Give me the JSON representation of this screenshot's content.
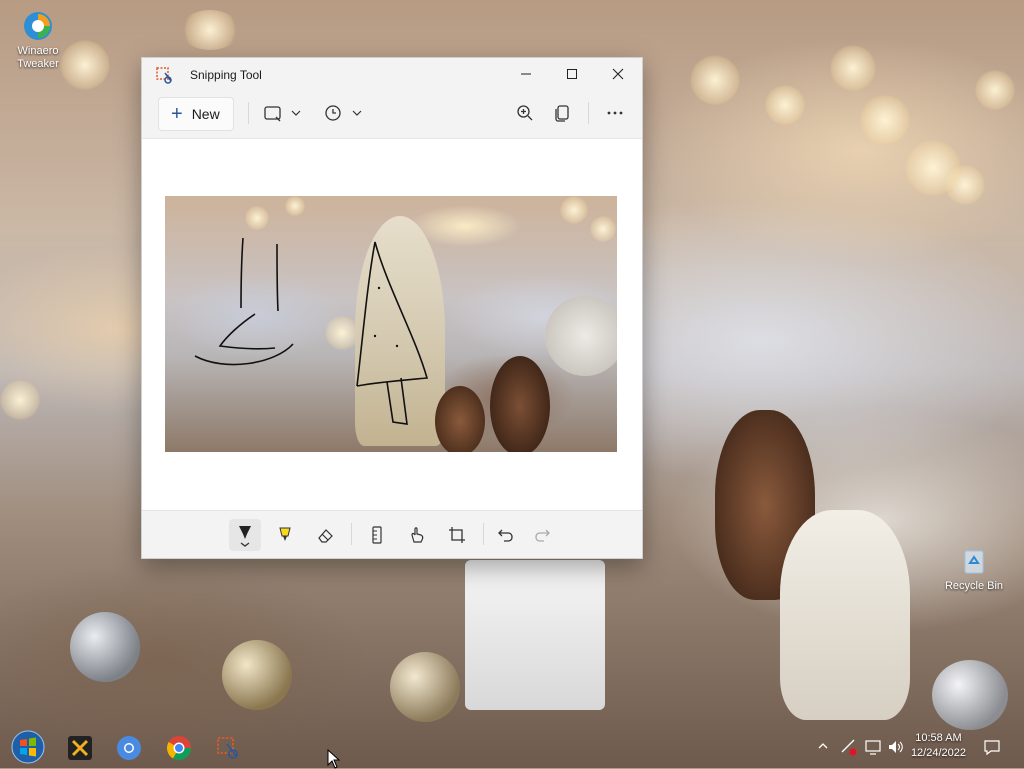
{
  "desktop": {
    "icons": [
      {
        "label": "Winaero Tweaker",
        "icon": "winaero-tweaker-icon"
      },
      {
        "label": "Recycle Bin",
        "icon": "recycle-bin-icon"
      }
    ]
  },
  "window": {
    "title": "Snipping Tool",
    "app_icon": "scissors-icon",
    "controls": {
      "minimize": "minimize-icon",
      "maximize": "maximize-icon",
      "close": "close-icon"
    },
    "toolbar": {
      "new_label": "New",
      "new_icon": "plus-icon",
      "snip_mode_icon": "rectangle-snip-icon",
      "delay_icon": "clock-icon",
      "zoom_icon": "zoom-in-icon",
      "copy_icon": "copy-icon",
      "more_icon": "more-icon"
    },
    "draw_tools": [
      {
        "name": "ballpoint-pen",
        "icon": "pen-icon",
        "active": true
      },
      {
        "name": "highlighter",
        "icon": "highlighter-icon",
        "active": false
      },
      {
        "name": "eraser",
        "icon": "eraser-icon",
        "active": false
      },
      {
        "name": "ruler",
        "icon": "ruler-icon",
        "active": false
      },
      {
        "name": "touch-writing",
        "icon": "touch-writing-icon",
        "active": false
      },
      {
        "name": "crop",
        "icon": "crop-icon",
        "active": false
      },
      {
        "name": "undo",
        "icon": "undo-icon",
        "active": false
      },
      {
        "name": "redo",
        "icon": "redo-icon",
        "active": false
      }
    ],
    "accent": "#2b5797"
  },
  "taskbar": {
    "apps": [
      "start-orb-icon",
      "winaero-app-icon",
      "chromium-icon",
      "chrome-icon",
      "snipping-tool-icon"
    ],
    "clock": {
      "time": "10:58 AM",
      "date": "12/24/2022"
    },
    "tray_icons": [
      "show-hidden-icon",
      "network-warning-icon",
      "display-icon",
      "volume-icon",
      "notification-icon"
    ]
  }
}
